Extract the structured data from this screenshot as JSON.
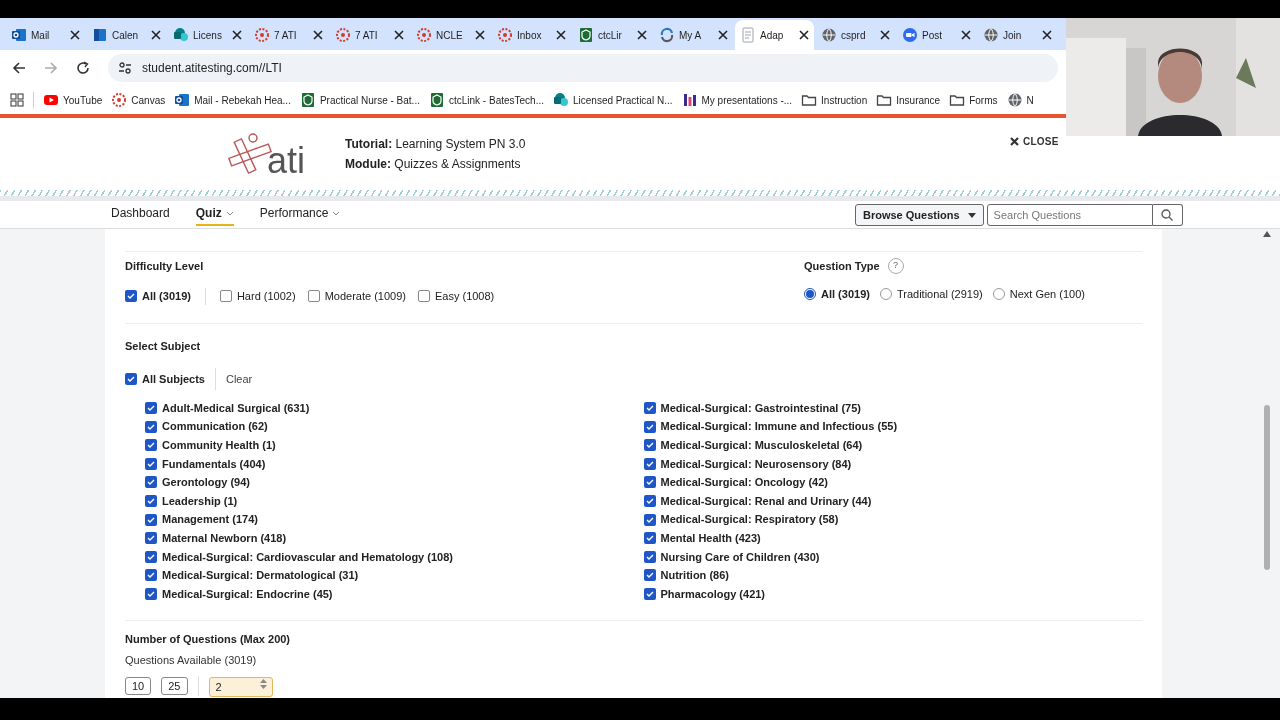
{
  "browser": {
    "tabs": [
      {
        "label": "Mail",
        "kind": "outlook",
        "selected": false
      },
      {
        "label": "Calen",
        "kind": "calendar",
        "selected": false
      },
      {
        "label": "Licens",
        "kind": "sharepoint",
        "selected": false
      },
      {
        "label": "7 ATI",
        "kind": "canvas",
        "selected": false
      },
      {
        "label": "7 ATI",
        "kind": "canvas",
        "selected": false
      },
      {
        "label": "NCLE",
        "kind": "canvas",
        "selected": false
      },
      {
        "label": "Inbox",
        "kind": "canvas",
        "selected": false
      },
      {
        "label": "ctcLir",
        "kind": "shield",
        "selected": false
      },
      {
        "label": "My A",
        "kind": "swirl",
        "selected": false
      },
      {
        "label": "Adap",
        "kind": "doc",
        "selected": true
      },
      {
        "label": "csprd",
        "kind": "globe",
        "selected": false
      },
      {
        "label": "Post",
        "kind": "zoom",
        "selected": false
      },
      {
        "label": "Join",
        "kind": "globe",
        "selected": false
      }
    ],
    "address": "student.atitesting.com//LTI",
    "bookmarks": [
      {
        "label": "YouTube",
        "kind": "youtube"
      },
      {
        "label": "Canvas",
        "kind": "canvas"
      },
      {
        "label": "Mail - Rebekah Hea...",
        "kind": "outlook"
      },
      {
        "label": "Practical Nurse - Bat...",
        "kind": "shield"
      },
      {
        "label": "ctcLink - BatesTech...",
        "kind": "shield"
      },
      {
        "label": "Licensed Practical N...",
        "kind": "sharepoint"
      },
      {
        "label": "My presentations -...",
        "kind": "slides"
      },
      {
        "label": "Instruction",
        "kind": "folder"
      },
      {
        "label": "Insurance",
        "kind": "folder"
      },
      {
        "label": "Forms",
        "kind": "folder"
      },
      {
        "label": "N",
        "kind": "globe"
      }
    ]
  },
  "header": {
    "logo": "ati",
    "tutorial": "**Tutorial:** Learning System PN 3.0",
    "module": "**Module:** Quizzes & Assignments",
    "close": "CLOSE"
  },
  "nav": {
    "items": [
      {
        "label": "Dashboard",
        "selected": false,
        "dropdown": false
      },
      {
        "label": "Quiz",
        "selected": true,
        "dropdown": true
      },
      {
        "label": "Performance",
        "selected": false,
        "dropdown": true
      }
    ],
    "browse_button": "Browse Questions",
    "search": {
      "placeholder": "Search Questions"
    }
  },
  "difficulty": {
    "title": "Difficulty Level",
    "options": [
      {
        "label": "All (3019)",
        "checked": true
      },
      {
        "label": "Hard (1002)",
        "checked": false
      },
      {
        "label": "Moderate (1009)",
        "checked": false
      },
      {
        "label": "Easy (1008)",
        "checked": false
      }
    ]
  },
  "question_type": {
    "title": "Question Type",
    "help": "?",
    "options": [
      {
        "label": "All (3019)",
        "selected": true
      },
      {
        "label": "Traditional (2919)",
        "selected": false
      },
      {
        "label": "Next Gen (100)",
        "selected": false
      }
    ]
  },
  "subjects": {
    "title": "Select Subject",
    "all": {
      "label": "All Subjects",
      "checked": true
    },
    "clear": "Clear",
    "items": [
      {
        "label": "Adult-Medical Surgical (631)",
        "checked": true
      },
      {
        "label": "Communication (62)",
        "checked": true
      },
      {
        "label": "Community Health (1)",
        "checked": true
      },
      {
        "label": "Fundamentals (404)",
        "checked": true
      },
      {
        "label": "Gerontology (94)",
        "checked": true
      },
      {
        "label": "Leadership (1)",
        "checked": true
      },
      {
        "label": "Management (174)",
        "checked": true
      },
      {
        "label": "Maternal Newborn (418)",
        "checked": true
      },
      {
        "label": "Medical-Surgical: Cardiovascular and Hematology (108)",
        "checked": true
      },
      {
        "label": "Medical-Surgical: Dermatological (31)",
        "checked": true
      },
      {
        "label": "Medical-Surgical: Endocrine (45)",
        "checked": true
      },
      {
        "label": "Medical-Surgical: Gastrointestinal (75)",
        "checked": true
      },
      {
        "label": "Medical-Surgical: Immune and Infectious (55)",
        "checked": true
      },
      {
        "label": "Medical-Surgical: Musculoskeletal (64)",
        "checked": true
      },
      {
        "label": "Medical-Surgical: Neurosensory (84)",
        "checked": true
      },
      {
        "label": "Medical-Surgical: Oncology (42)",
        "checked": true
      },
      {
        "label": "Medical-Surgical: Renal and Urinary (44)",
        "checked": true
      },
      {
        "label": "Medical-Surgical: Respiratory (58)",
        "checked": true
      },
      {
        "label": "Mental Health (423)",
        "checked": true
      },
      {
        "label": "Nursing Care of Children (430)",
        "checked": true
      },
      {
        "label": "Nutrition (86)",
        "checked": true
      },
      {
        "label": "Pharmacology (421)",
        "checked": true
      }
    ]
  },
  "number": {
    "title": "Number of Questions (Max 200)",
    "available": "Questions Available (3019)",
    "presets": [
      "10",
      "25"
    ],
    "value": "2"
  }
}
